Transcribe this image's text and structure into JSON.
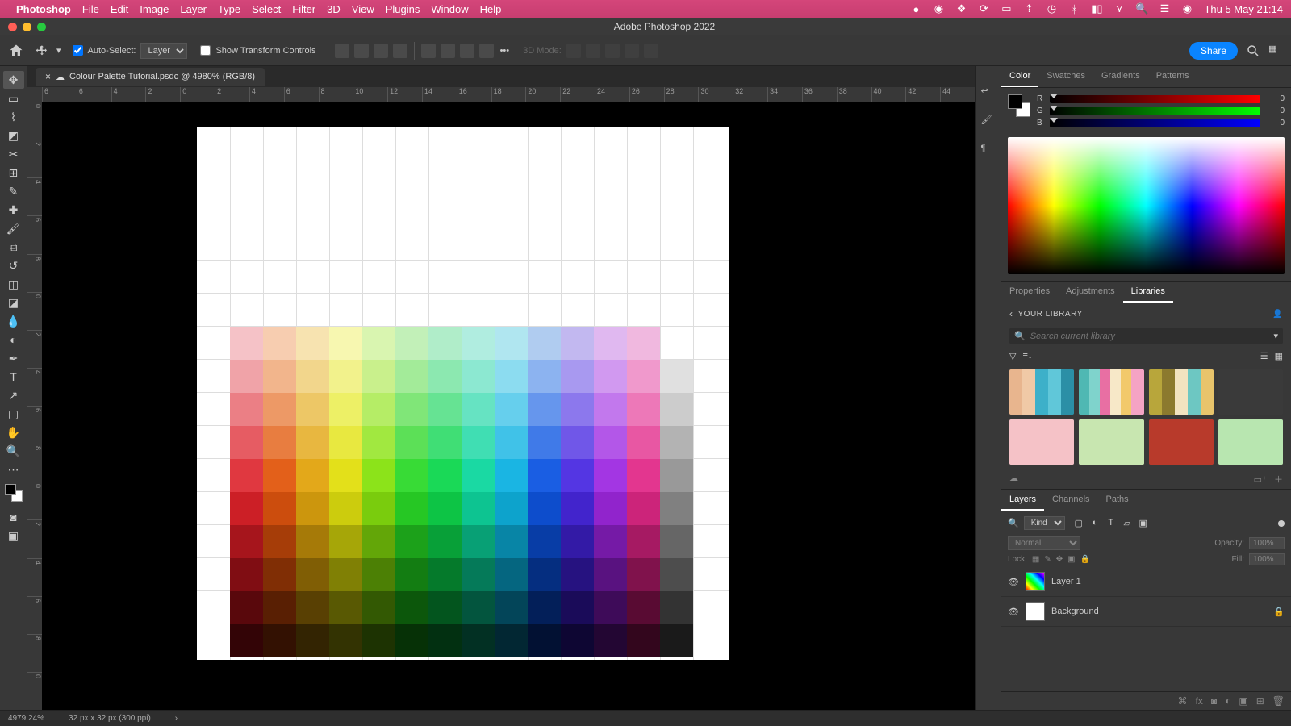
{
  "menubar": {
    "app_name": "Photoshop",
    "items": [
      "File",
      "Edit",
      "Image",
      "Layer",
      "Type",
      "Select",
      "Filter",
      "3D",
      "View",
      "Plugins",
      "Window",
      "Help"
    ],
    "clock": "Thu 5 May  21:14"
  },
  "window": {
    "title": "Adobe Photoshop 2022"
  },
  "options": {
    "auto_select": "Auto-Select:",
    "layer_dropdown": "Layer",
    "show_transform": "Show Transform Controls",
    "three_d_label": "3D Mode:",
    "share": "Share"
  },
  "document": {
    "tab_label": "Colour Palette Tutorial.psdc @ 4980% (RGB/8)"
  },
  "ruler_h": [
    "6",
    "6",
    "4",
    "2",
    "0",
    "2",
    "4",
    "6",
    "8",
    "10",
    "12",
    "14",
    "16",
    "18",
    "20",
    "22",
    "24",
    "26",
    "28",
    "30",
    "32",
    "34",
    "36",
    "38",
    "40",
    "42",
    "44"
  ],
  "ruler_v": [
    "0",
    "2",
    "4",
    "6",
    "8",
    "0",
    "2",
    "4",
    "6",
    "8",
    "0",
    "2",
    "4",
    "6",
    "8",
    "0"
  ],
  "panels": {
    "color_tabs": [
      "Color",
      "Swatches",
      "Gradients",
      "Patterns"
    ],
    "color_active": 0,
    "rgb": {
      "r": 0,
      "g": 0,
      "b": 0
    },
    "mid_tabs": [
      "Properties",
      "Adjustments",
      "Libraries"
    ],
    "mid_active": 2,
    "library_title": "YOUR LIBRARY",
    "library_search_placeholder": "Search current library",
    "library_items": [
      "linear-gradient(to right,#e8b58e 0 20%,#f0c9a6 20% 40%,#3db0c9 40% 60%,#60c7d9 60% 80%,#2b8fa6 80% 100%)",
      "linear-gradient(to right,#4fb8b3 0 16%,#7fd3cc 16% 32%,#e86fa3 32% 48%,#f7e8c8 48% 64%,#f2c96b 64% 80%,#f5a3c4 80% 100%)",
      "linear-gradient(to right,#b8a63b 0 20%,#8c7a2e 20% 40%,#f2e3c0 40% 60%,#6dc7c2 60% 80%,#e8c46b 80% 100%)",
      "#3a3a3a",
      "#f5c2c7",
      "#c8e6b0",
      "#b83a2b",
      "#b8e6b0"
    ],
    "layers_tabs": [
      "Layers",
      "Channels",
      "Paths"
    ],
    "layers_active": 0,
    "kind": "Kind",
    "blend_mode": "Normal",
    "opacity_label": "Opacity:",
    "opacity_val": "100%",
    "lock_label": "Lock:",
    "fill_label": "Fill:",
    "fill_val": "100%",
    "layers": [
      {
        "name": "Layer 1",
        "thumb": "rainbow",
        "locked": false
      },
      {
        "name": "Background",
        "thumb": "white",
        "locked": true
      }
    ]
  },
  "status": {
    "zoom": "4979.24%",
    "dims": "32 px x 32 px (300 ppi)"
  },
  "palette_colors": [
    [
      "#f5c2c7",
      "#f7cdb0",
      "#f7e3b0",
      "#f7f7b0",
      "#d9f5b0",
      "#c2f0b8",
      "#b0edc9",
      "#b0ede0",
      "#b0e6f0",
      "#b0ccf0",
      "#c2b8f0",
      "#e0b8f0",
      "#f0b8df"
    ],
    [
      "#f0a3a8",
      "#f2b58c",
      "#f2d68c",
      "#f2f28c",
      "#c9f08c",
      "#a3eb99",
      "#8ce8b0",
      "#8ce8d1",
      "#8cdcf0",
      "#8cb3f0",
      "#a899f0",
      "#d199f0",
      "#f099cc",
      "#e0e0e0"
    ],
    [
      "#eb7f85",
      "#ed9966",
      "#edc766",
      "#edf066",
      "#b5ed66",
      "#80e678",
      "#66e393",
      "#66e3c2",
      "#66cfed",
      "#6696ed",
      "#8c78ed",
      "#c278ed",
      "#ed78b8",
      "#cccccc"
    ],
    [
      "#e65c63",
      "#e87d40",
      "#e8b740",
      "#e8e840",
      "#a1e840",
      "#5ce057",
      "#40de75",
      "#40deb3",
      "#40c2e8",
      "#407ae8",
      "#7057e8",
      "#b357e8",
      "#e857a3",
      "#b3b3b3"
    ],
    [
      "#e03840",
      "#e3601a",
      "#e3a81a",
      "#e3e01a",
      "#8ce31a",
      "#38db36",
      "#1ad957",
      "#1ad9a3",
      "#1ab5e3",
      "#1a5ee3",
      "#5436e3",
      "#a336e3",
      "#e3368f",
      "#999999"
    ],
    [
      "#cc1f26",
      "#cc4d0d",
      "#cc960d",
      "#cccc0d",
      "#7acc0d",
      "#26c724",
      "#0dc445",
      "#0dc491",
      "#0da3cc",
      "#0d4dcc",
      "#4224cc",
      "#9124cc",
      "#cc247a",
      "#808080"
    ],
    [
      "#a6151c",
      "#a63d08",
      "#a67a08",
      "#a6a608",
      "#63a608",
      "#1ca11a",
      "#08a038",
      "#08a075",
      "#0885a6",
      "#083da6",
      "#331aa6",
      "#751aa6",
      "#a61a63",
      "#666666"
    ],
    [
      "#800d13",
      "#802e05",
      "#805e05",
      "#808005",
      "#4c8005",
      "#137d12",
      "#057a2b",
      "#057a59",
      "#056680",
      "#052e80",
      "#261280",
      "#591280",
      "#80124c",
      "#4d4d4d"
    ],
    [
      "#59080c",
      "#591f03",
      "#594003",
      "#595903",
      "#335903",
      "#0c570b",
      "#03551e",
      "#03553e",
      "#034559",
      "#031f59",
      "#1a0b59",
      "#3e0b59",
      "#590b33",
      "#333333"
    ],
    [
      "#330406",
      "#331102",
      "#332402",
      "#333302",
      "#1d3302",
      "#063106",
      "#023011",
      "#023023",
      "#022733",
      "#021133",
      "#0e0633",
      "#230633",
      "#33061d",
      "#1a1a1a"
    ]
  ]
}
